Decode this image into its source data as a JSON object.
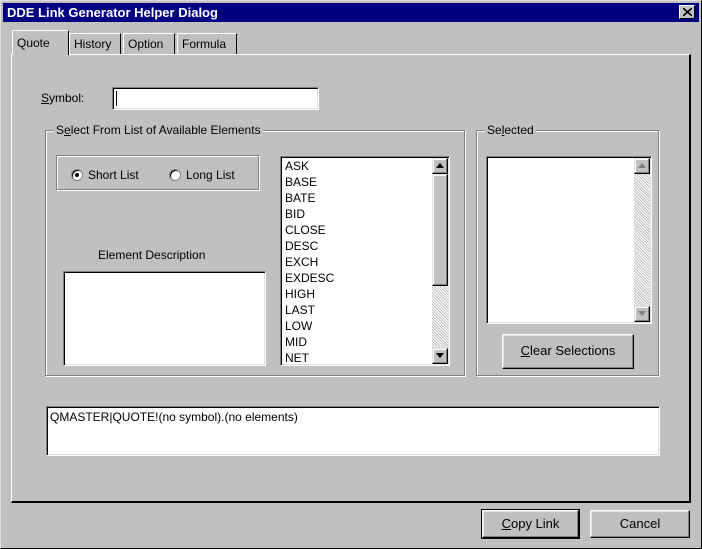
{
  "window": {
    "title": "DDE Link Generator Helper Dialog"
  },
  "tabs": [
    {
      "label": "Quote",
      "active": true
    },
    {
      "label": "History",
      "active": false
    },
    {
      "label": "Option",
      "active": false
    },
    {
      "label": "Formula",
      "active": false
    }
  ],
  "quote": {
    "symbol_label_mnemonic": "S",
    "symbol_label_rest": "ymbol:",
    "symbol_value": "",
    "available_group_pre": "S",
    "available_group_mnemonic": "e",
    "available_group_rest": "lect From List of Available Elements",
    "short_list_label": "Short List",
    "long_list_label": "Long List",
    "short_list_selected": true,
    "element_description_label": "Element Description",
    "element_description_value": "",
    "available_elements": [
      "ASK",
      "BASE",
      "BATE",
      "BID",
      "CLOSE",
      "DESC",
      "EXCH",
      "EXDESC",
      "HIGH",
      "LAST",
      "LOW",
      "MID",
      "NET"
    ],
    "selected_group_pre": "Se",
    "selected_group_mnemonic": "l",
    "selected_group_rest": "ected",
    "selected_elements": [],
    "clear_selections_mnemonic": "C",
    "clear_selections_rest": "lear Selections",
    "link_output": "QMASTER|QUOTE!(no symbol).(no elements)"
  },
  "buttons": {
    "copy_link_mnemonic": "C",
    "copy_link_rest": "opy Link",
    "cancel_label": "Cancel"
  },
  "icons": {
    "close": "close-icon",
    "scroll_up": "arrow-up-icon",
    "scroll_down": "arrow-down-icon"
  }
}
